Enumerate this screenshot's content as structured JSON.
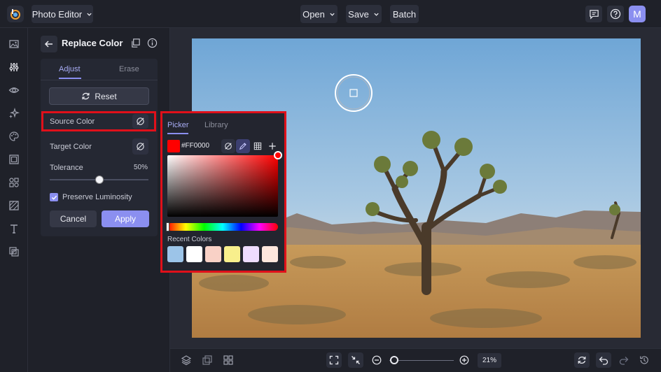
{
  "topbar": {
    "app_menu_label": "Photo Editor",
    "open_label": "Open",
    "save_label": "Save",
    "batch_label": "Batch",
    "avatar_initial": "M"
  },
  "panel": {
    "title": "Replace Color",
    "tabs": [
      {
        "label": "Adjust",
        "active": true
      },
      {
        "label": "Erase",
        "active": false
      }
    ],
    "reset_label": "Reset",
    "source_color_label": "Source Color",
    "target_color_label": "Target Color",
    "tolerance_label": "Tolerance",
    "tolerance_value": "50%",
    "tolerance_fraction": 0.5,
    "preserve_luminosity_label": "Preserve Luminosity",
    "preserve_luminosity_checked": true,
    "cancel_label": "Cancel",
    "apply_label": "Apply"
  },
  "picker": {
    "tabs": [
      {
        "label": "Picker",
        "active": true
      },
      {
        "label": "Library",
        "active": false
      }
    ],
    "hex_value": "#FF0000",
    "current_color": "#FF0000",
    "recent_label": "Recent Colors",
    "recent_colors": [
      "#9cc4e8",
      "#ffffff",
      "#f9d1c6",
      "#f8ef8c",
      "#eedcff",
      "#fde6dd"
    ]
  },
  "bottombar": {
    "zoom_value": "21%",
    "zoom_fraction": 0.08
  },
  "colors": {
    "accent": "#8b8ff0",
    "highlight": "#e0101a",
    "panel_bg": "#1f2129",
    "canvas_bg": "#282a34"
  },
  "icons": {
    "left_nav": [
      "image-icon",
      "sliders-icon",
      "eye-icon",
      "sparkle-icon",
      "palette-icon",
      "frame-icon",
      "shapes-icon",
      "texture-icon",
      "text-icon",
      "layers-icon"
    ]
  }
}
